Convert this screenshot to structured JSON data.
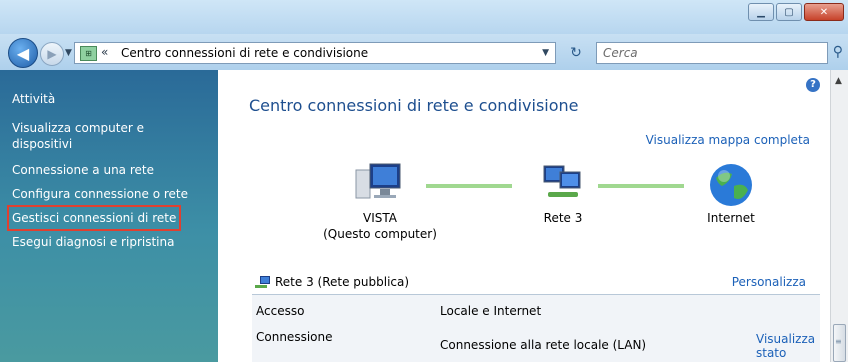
{
  "window": {
    "minimize_icon": "minimize-icon",
    "maximize_icon": "maximize-icon",
    "close_icon": "close-icon"
  },
  "navbar": {
    "back_icon": "back-arrow-icon",
    "forward_icon": "forward-arrow-icon",
    "address_chevron": "«",
    "address_text": "Centro connessioni di rete e condivisione",
    "search_placeholder": "Cerca"
  },
  "sidebar": {
    "title": "Attività",
    "items": [
      {
        "label": "Visualizza computer e dispositivi"
      },
      {
        "label": "Connessione a una rete"
      },
      {
        "label": "Configura connessione o rete"
      },
      {
        "label": "Gestisci connessioni di rete",
        "highlighted": true
      },
      {
        "label": "Esegui diagnosi e ripristina"
      }
    ]
  },
  "main": {
    "title": "Centro connessioni di rete e condivisione",
    "view_full_map": "Visualizza mappa completa",
    "map": {
      "computer_name": "VISTA",
      "computer_sub": "(Questo computer)",
      "network_name": "Rete  3",
      "internet_name": "Internet"
    },
    "network": {
      "title": "Rete  3 (Rete pubblica)",
      "customize": "Personalizza",
      "rows": [
        {
          "key": "Accesso",
          "value": "Locale e Internet"
        },
        {
          "key": "Connessione",
          "value": "Connessione alla rete locale (LAN)"
        }
      ],
      "status_link": "Visualizza stato"
    }
  },
  "colors": {
    "sidebar_top": "#2a6a98",
    "link": "#1c61b8",
    "title": "#1e4f8f",
    "highlight_box": "#e04030"
  }
}
